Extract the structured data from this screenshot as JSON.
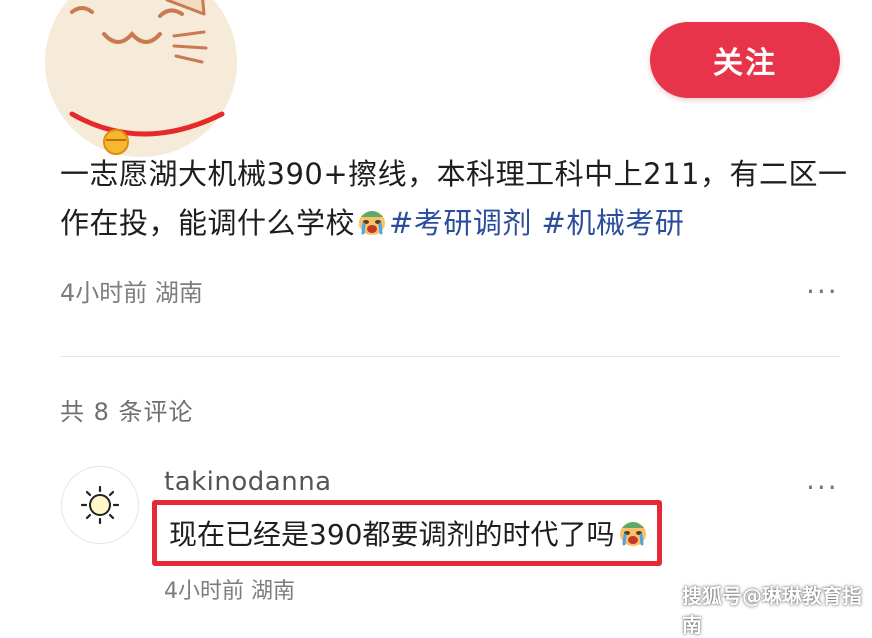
{
  "post": {
    "follow_label": "关注",
    "text_main": "一志愿湖大机械390+擦线，本科理工科中上211，有二区一作在投，能调什么学校",
    "tags": [
      "#考研调剂",
      "#机械考研"
    ],
    "time": "4小时前",
    "location": "湖南",
    "more_label": "···"
  },
  "comments": {
    "count_label": "共 8 条评论",
    "items": [
      {
        "username": "takinodanna",
        "text": "现在已经是390都要调剂的时代了吗",
        "time": "4小时前",
        "location": "湖南",
        "more_label": "···"
      }
    ]
  },
  "watermark": "搜狐号@琳琳教育指南",
  "colors": {
    "follow_button": "#e8344b",
    "hashtag": "#2b4d9c",
    "highlight_box": "#e52a35"
  },
  "icons": [
    "cat-avatar-icon",
    "crying-emoji-icon",
    "sun-avatar-icon",
    "more-dots-icon"
  ]
}
